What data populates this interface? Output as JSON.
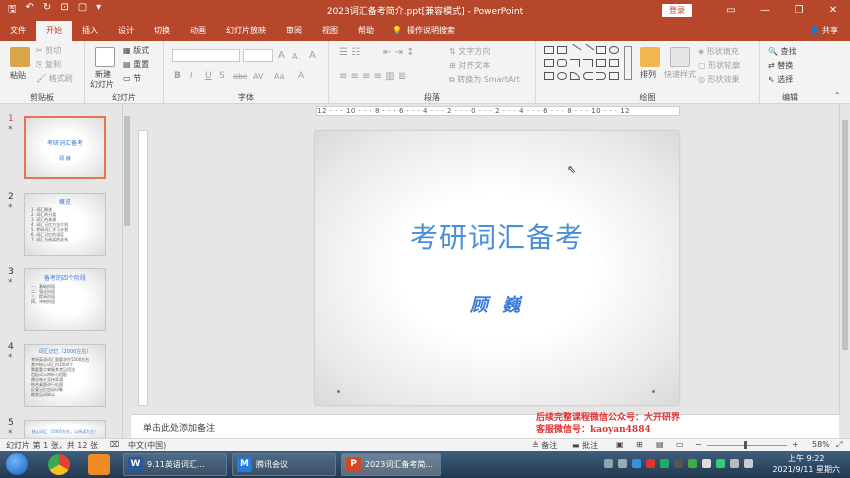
{
  "window": {
    "title": "2023词汇备考简介.ppt[兼容模式] - PowerPoint",
    "signin_label": "登录",
    "win_controls": [
      "▭",
      "—",
      "❐",
      "✕"
    ]
  },
  "quick_access": [
    "🖫",
    "↶",
    "↻",
    "⊡",
    "▢",
    "▾"
  ],
  "tabs": [
    "文件",
    "开始",
    "插入",
    "设计",
    "切换",
    "动画",
    "幻灯片放映",
    "审阅",
    "视图",
    "帮助"
  ],
  "tell_me": "操作说明搜索",
  "share": "共享",
  "ribbon": {
    "clipboard": {
      "paste": "粘贴",
      "cut": "剪切",
      "copy": "复制",
      "format_painter": "格式刷",
      "label": "剪贴板"
    },
    "slides": {
      "new_slide": "新建",
      "new_slide2": "幻灯片",
      "layout": "版式",
      "reset": "重置",
      "section": "节",
      "label": "幻灯片"
    },
    "font": {
      "label": "字体",
      "size_up": "A",
      "size_down": "A",
      "clear": "A",
      "bold": "B",
      "italic": "I",
      "underline": "U",
      "shadow": "S",
      "strike": "abc",
      "spacing": "AV",
      "case": "Aa",
      "color": "A"
    },
    "paragraph": {
      "label": "段落",
      "text_direction": "文字方向",
      "align_text": "对齐文本",
      "smartart": "转换为 SmartArt"
    },
    "drawing": {
      "arrange": "排列",
      "quick_styles": "快速样式",
      "fill": "形状填充",
      "outline": "形状轮廓",
      "effects": "形状效果",
      "label": "绘图"
    },
    "editing": {
      "find": "查找",
      "replace": "替换",
      "select": "选择",
      "label": "编辑"
    }
  },
  "ruler_text": "12 · · · 10 · · · 8 · · · 6 · · · 4 · · · 2 · · · 0 · · · 2 · · · 4 · · · 6 · · · 8 · · · 10 · · · 12",
  "thumbnails": [
    {
      "num": "1",
      "title": "考研词汇备考",
      "sub": "顾 巍"
    },
    {
      "num": "2",
      "title": "概览",
      "lines": [
        "1. 词汇概述",
        "2. 词汇的分类",
        "3. 词汇的来源",
        "4. 词汇记忆方法介绍",
        "5. 考研词汇学习计划",
        "6. 词汇记忆的误区",
        "7. 词汇与阅读的关系"
      ]
    },
    {
      "num": "3",
      "title": "备考的四个阶段",
      "lines": [
        "一、基础阶段",
        "二、强化阶段",
        "三、提高阶段",
        "四、冲刺阶段"
      ]
    },
    {
      "num": "4",
      "title": "词汇记忆（2000左右）",
      "lines": [
        "考研英语词汇量要求在5500左右",
        "其中核心词汇约2000个",
        "需要重点掌握其常见用法",
        "包括词义辨析与搭配",
        "建议每天坚持背诵",
        "结合真题进行巩固",
        "反复记忆加深印象",
        "做到见词知义"
      ]
    },
    {
      "num": "5",
      "title": "核心词汇（5000左右，以阅读为主）"
    }
  ],
  "slide": {
    "title": "考研词汇备考",
    "author": "顾 巍"
  },
  "notes_placeholder": "单击此处添加备注",
  "watermark": {
    "line1": "后续完整课程微信公众号：大开研界",
    "line2": "客服微信号：kaoyan4884"
  },
  "status": {
    "slide_info": "幻灯片 第 1 张，共 12 张",
    "language": "中文(中国)",
    "notes": "备注",
    "comments": "批注",
    "zoom": "58%"
  },
  "taskbar": {
    "apps": [
      {
        "icon": "W",
        "label": "9.11英语词汇..."
      },
      {
        "icon": "M",
        "label": "腾讯会议"
      },
      {
        "icon": "P",
        "label": "2023词汇备考简..."
      }
    ],
    "time": "上午 9:22",
    "date": "2021/9/11 星期六"
  },
  "colors": {
    "accent": "#b7472a",
    "slide_title": "#4a8ed9",
    "watermark": "#e03232",
    "taskbar": "#2c4660"
  }
}
